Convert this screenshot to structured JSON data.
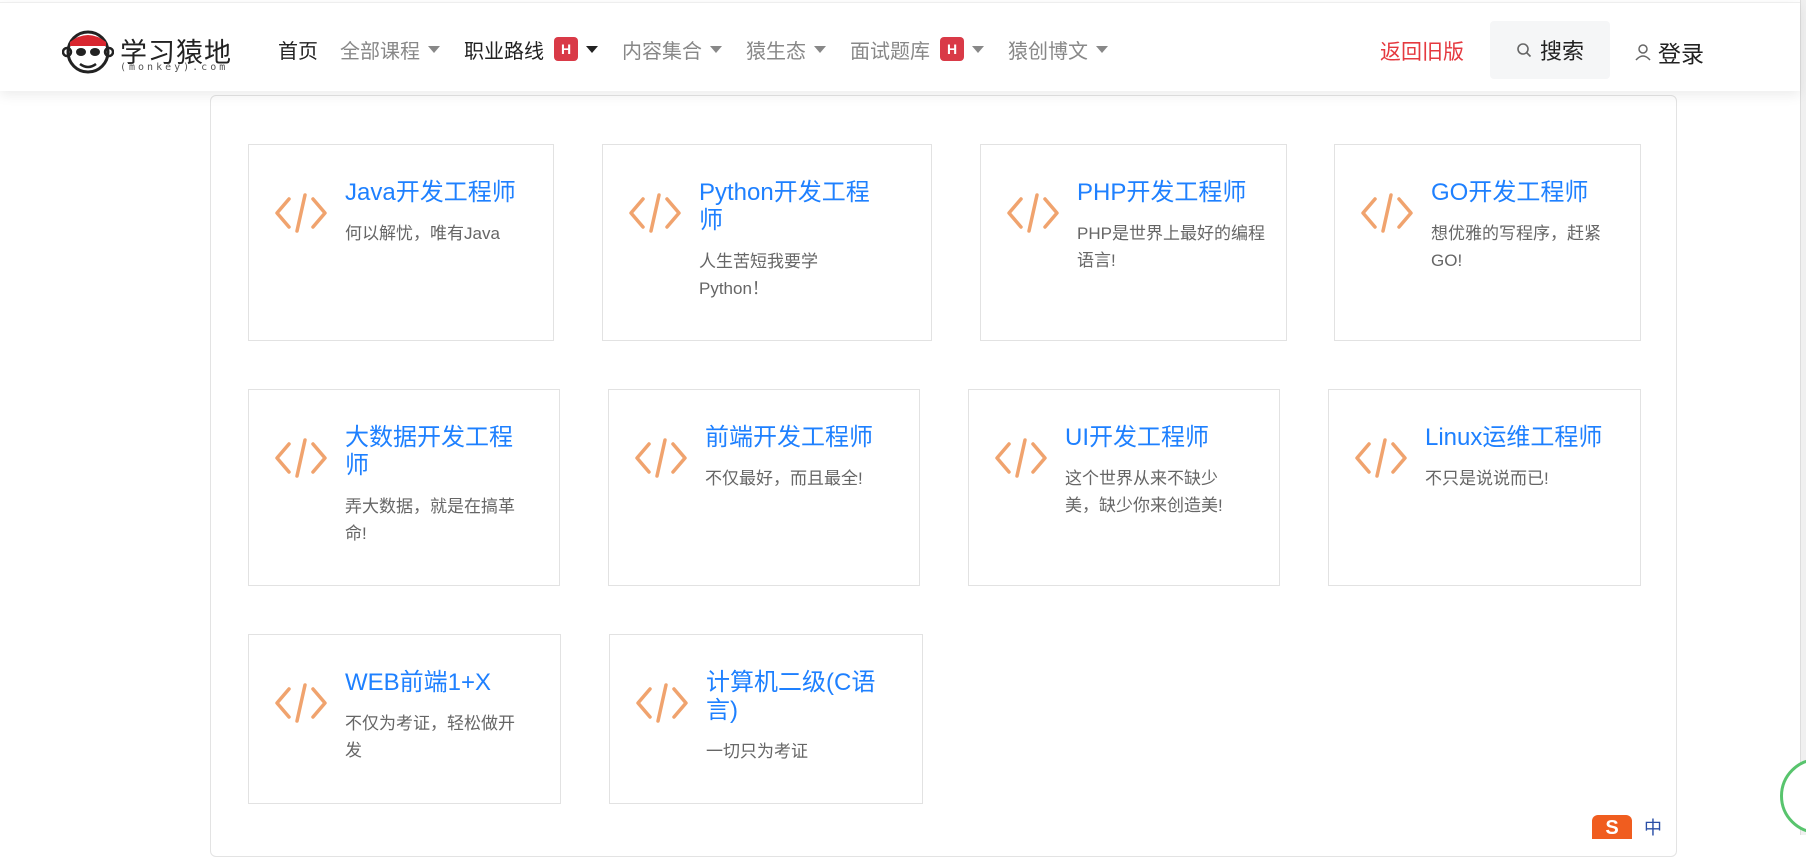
{
  "header": {
    "logo_text": "学习猿地",
    "logo_sub": "(monkey).com",
    "nav": [
      {
        "label": "首页",
        "caret": false,
        "hot": false,
        "style": "active"
      },
      {
        "label": "全部课程",
        "caret": true,
        "hot": false,
        "style": "muted"
      },
      {
        "label": "职业路线",
        "caret": true,
        "hot": true,
        "style": "dark"
      },
      {
        "label": "内容集合",
        "caret": true,
        "hot": false,
        "style": "muted"
      },
      {
        "label": "猿生态",
        "caret": true,
        "hot": false,
        "style": "muted"
      },
      {
        "label": "面试题库",
        "caret": true,
        "hot": true,
        "style": "muted"
      },
      {
        "label": "猿创博文",
        "caret": true,
        "hot": false,
        "style": "muted"
      }
    ],
    "hot_label": "H",
    "return_old": "返回旧版",
    "search_label": "搜索",
    "login_label": "登录"
  },
  "cards": [
    {
      "title": "Java开发工程师",
      "desc": "何以解忧，唯有Java"
    },
    {
      "title": "Python开发工程师",
      "desc": "人生苦短我要学Python！"
    },
    {
      "title": "PHP开发工程师",
      "desc": "PHP是世界上最好的编程语言!"
    },
    {
      "title": "GO开发工程师",
      "desc": "想优雅的写程序，赶紧GO!"
    },
    {
      "title": "大数据开发工程师",
      "desc": "弄大数据，就是在搞革命!"
    },
    {
      "title": "前端开发工程师",
      "desc": "不仅最好，而且最全!"
    },
    {
      "title": "UI开发工程师",
      "desc": "这个世界从来不缺少美，缺少你来创造美!"
    },
    {
      "title": "Linux运维工程师",
      "desc": "不只是说说而已!"
    },
    {
      "title": "WEB前端1+X",
      "desc": "不仅为考证，轻松做开发"
    },
    {
      "title": "计算机二级(C语言)",
      "desc": "一切只为考证"
    }
  ],
  "colors": {
    "link_blue": "#1e80ff",
    "icon_orange": "#f0a36e",
    "hot_red": "#d93a47",
    "return_red": "#e5393f"
  },
  "tray": {
    "s_logo": "S",
    "ime": "中"
  }
}
